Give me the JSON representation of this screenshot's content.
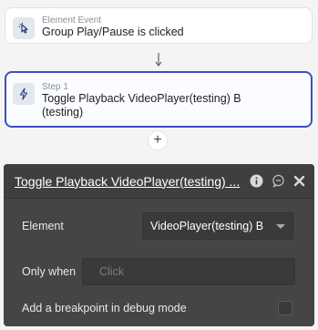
{
  "event": {
    "kicker": "Element Event",
    "title": "Group Play/Pause is clicked",
    "icon": "pointer-click-icon"
  },
  "step": {
    "kicker": "Step 1",
    "title_line1": "Toggle Playback VideoPlayer(testing) B",
    "title_line2": "(testing)",
    "icon": "action-bolt-icon"
  },
  "add_step_label": "+",
  "panel": {
    "title": "Toggle Playback VideoPlayer(testing) ...",
    "element_label": "Element",
    "element_value": "VideoPlayer(testing) B",
    "only_when_label": "Only when",
    "only_when_placeholder": "Click",
    "breakpoint_label": "Add a breakpoint in debug mode",
    "breakpoint_checked": false
  },
  "colors": {
    "step_border": "#3b4fc0",
    "panel_bg": "#454545"
  }
}
